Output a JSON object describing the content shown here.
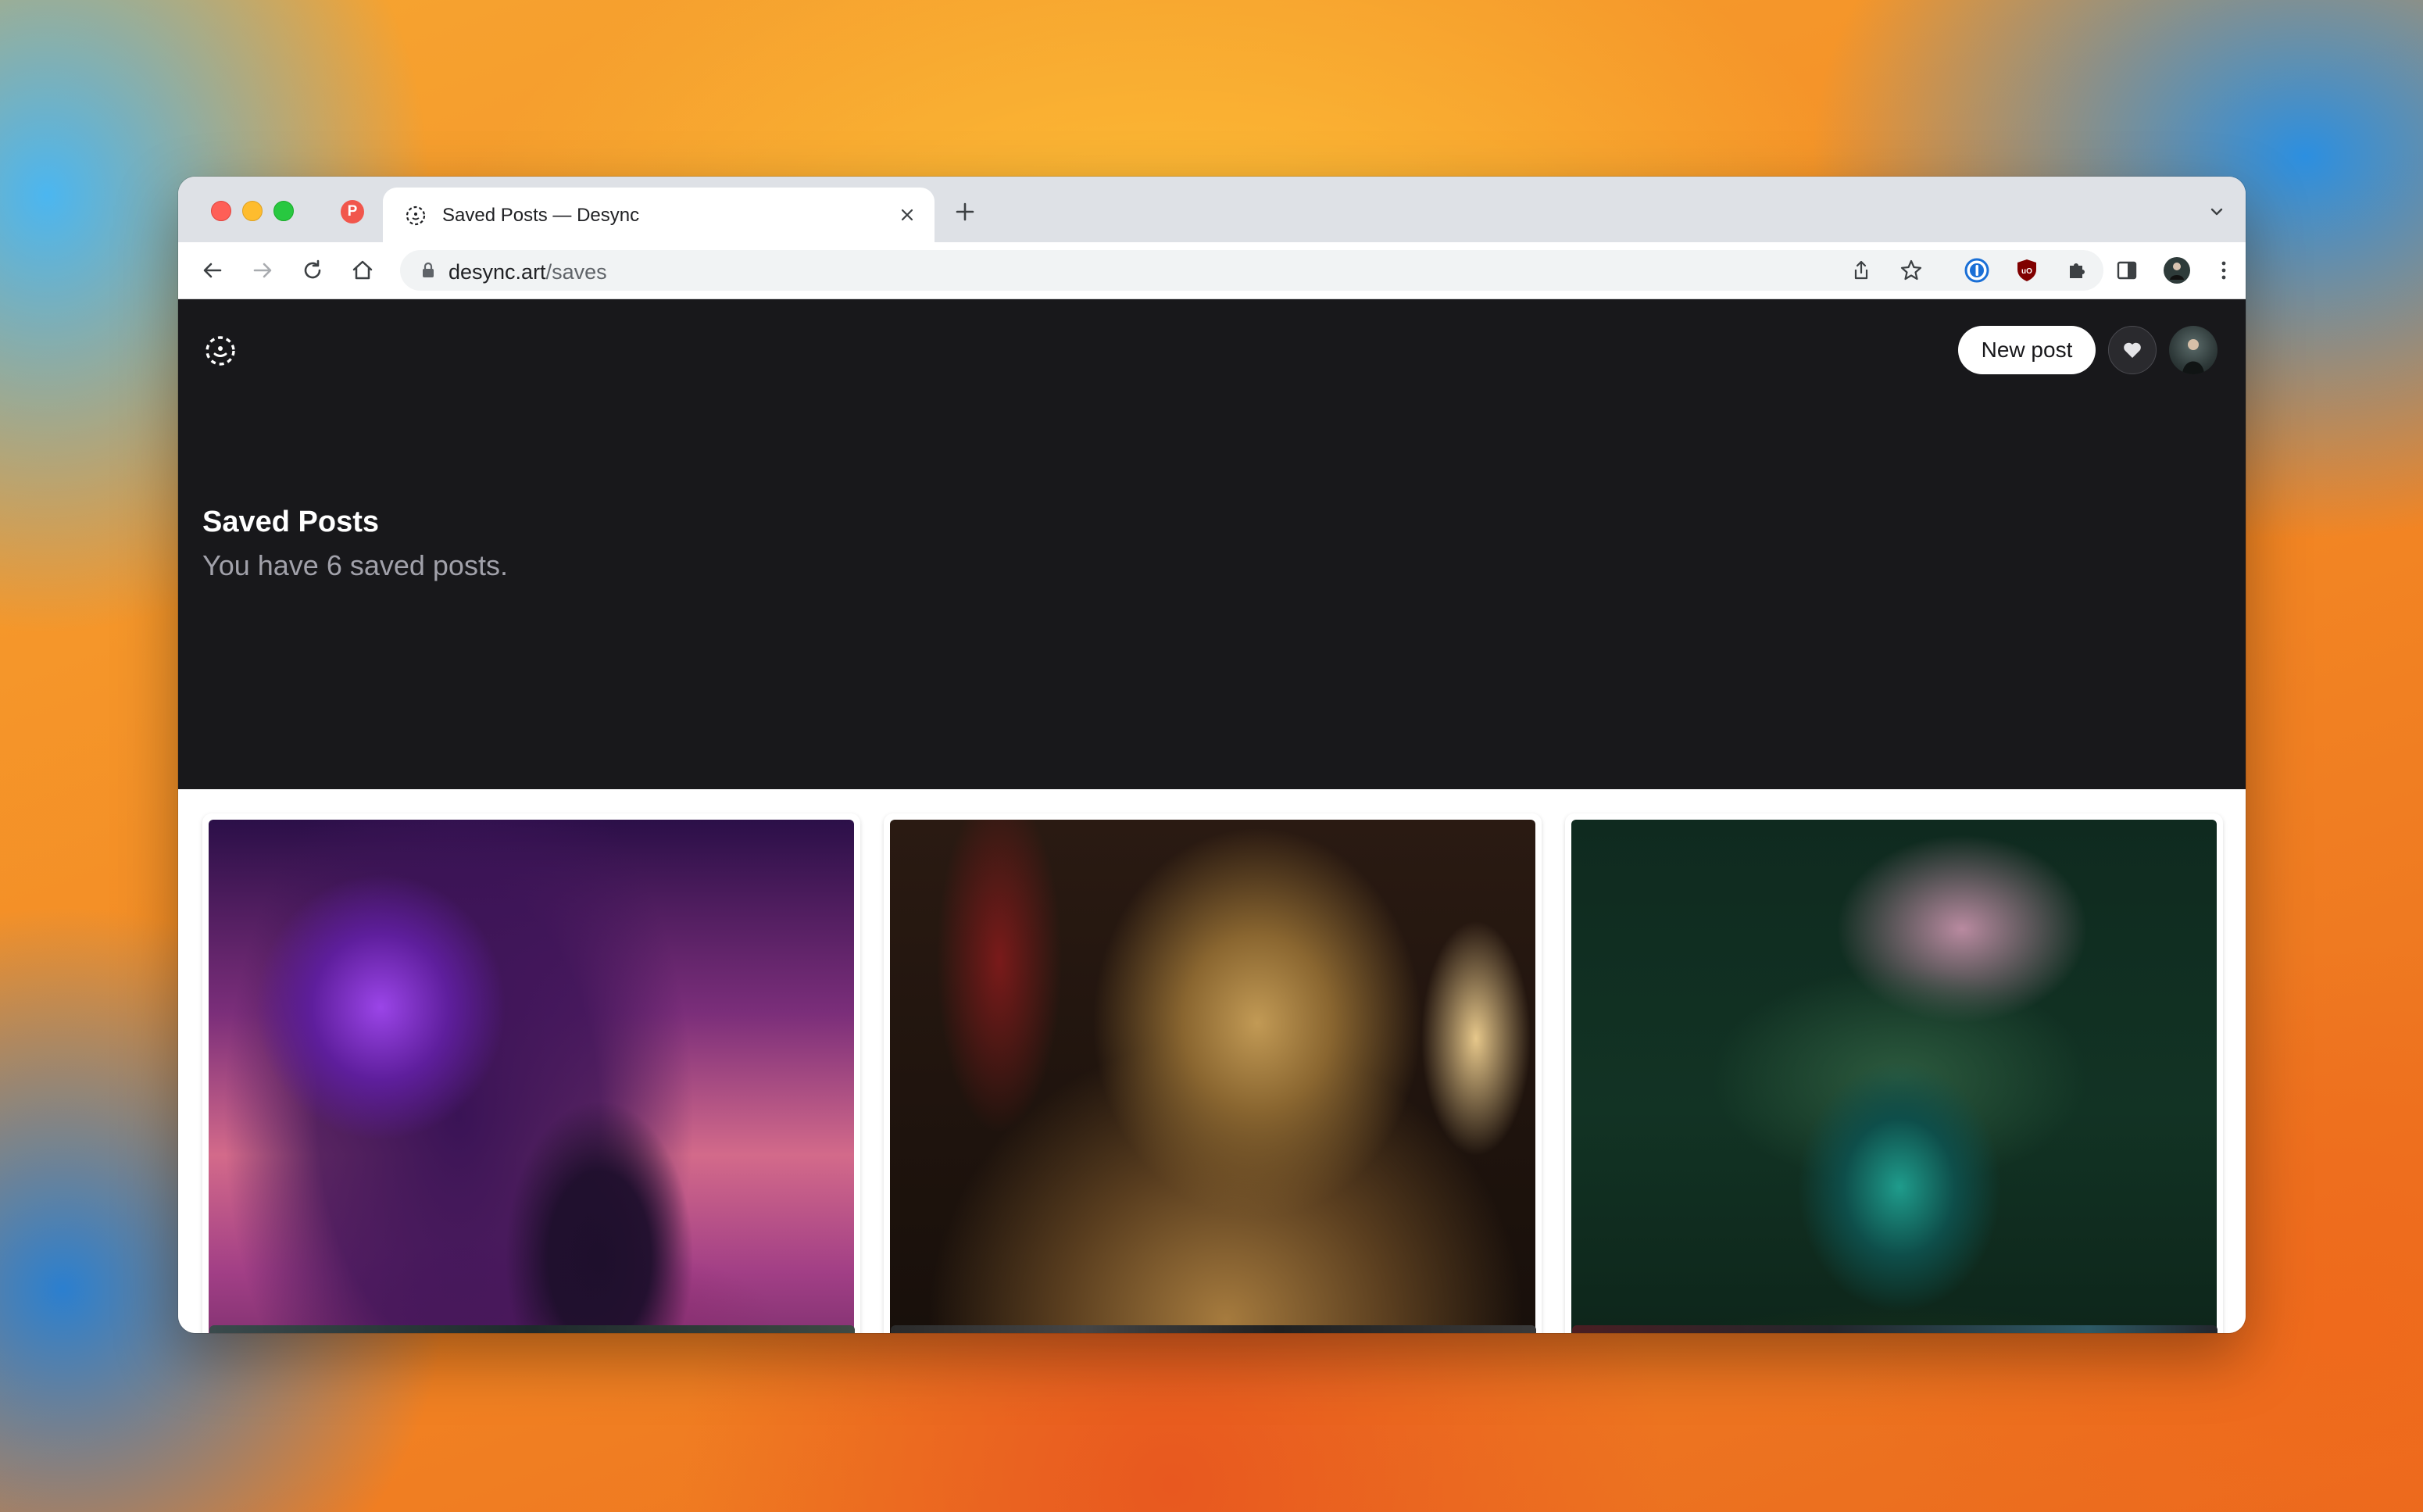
{
  "browser": {
    "pinned_tab_letter": "P",
    "active_tab_title": "Saved Posts — Desync",
    "url_host": "desync.art",
    "url_path": "/saves",
    "extension_icons": [
      "1password-icon",
      "ublock-origin-icon",
      "extensions-puzzle-icon",
      "side-panel-icon",
      "profile-avatar-icon",
      "chrome-menu-icon"
    ]
  },
  "header": {
    "new_post_label": "New post"
  },
  "main": {
    "title": "Saved Posts",
    "subtitle": "You have 6 saved posts.",
    "saved_posts": [
      {
        "image": "purple-alien-warrior-artwork"
      },
      {
        "image": "golden-armored-knight-artwork"
      },
      {
        "image": "glowing-circuit-tree-forest-artwork"
      },
      {
        "image": "saved-post-4-partial"
      },
      {
        "image": "saved-post-5-partial"
      },
      {
        "image": "saved-post-6-partial"
      }
    ]
  },
  "colors": {
    "page_dark": "#18181b",
    "subtitle": "#a1a1aa",
    "tab_strip": "#dee1e6"
  }
}
